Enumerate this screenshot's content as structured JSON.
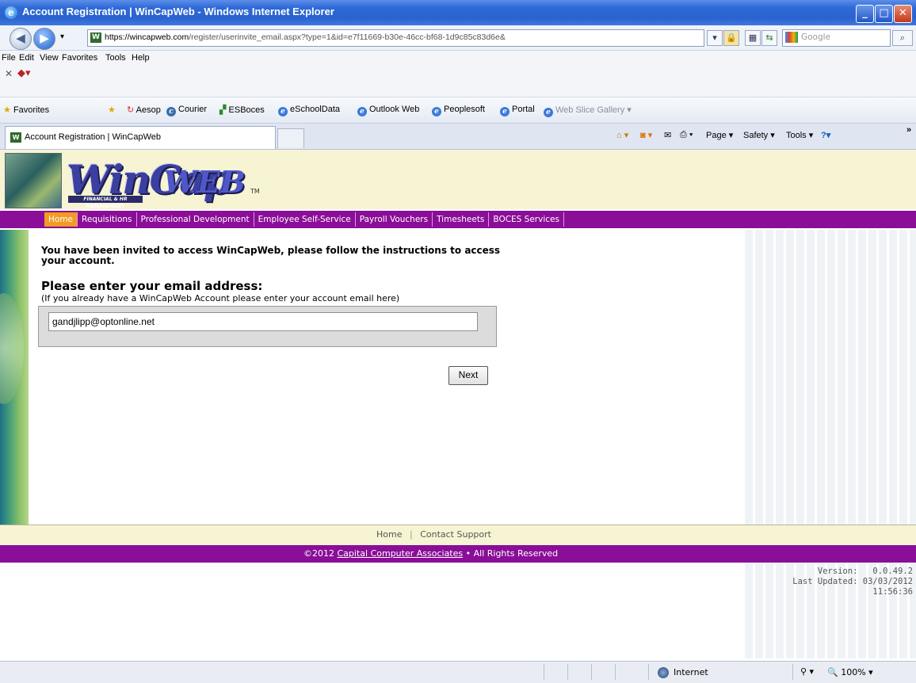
{
  "window": {
    "title": "Account Registration | WinCapWeb - Windows Internet Explorer",
    "minimize_icon": "minimize-icon",
    "maximize_icon": "maximize-icon",
    "close_icon": "close-icon"
  },
  "address": {
    "url_host": "https://wincapweb.com",
    "url_path": "/register/userinvite_email.aspx?type=1&id=e7f11669-b30e-46cc-bf68-1d9c85c83d6e&",
    "search_placeholder": "Google"
  },
  "menu": [
    "File",
    "Edit",
    "View",
    "Favorites",
    "Tools",
    "Help"
  ],
  "favorites_bar": {
    "favorites_label": "Favorites",
    "items": [
      "Aesop",
      "Courier",
      "ESBoces",
      "eSchoolData",
      "Outlook Web",
      "Peoplesoft",
      "Portal",
      "Web Slice Gallery"
    ]
  },
  "tab": {
    "label": "Account Registration | WinCapWeb"
  },
  "commands": {
    "page": "Page",
    "safety": "Safety",
    "tools": "Tools"
  },
  "logo": {
    "word": "WinCap",
    "web": "WEB",
    "sub": "FINANCIAL & HR MANAGEMENT",
    "tm": "TM"
  },
  "nav": [
    "Home",
    "Requisitions",
    "Professional Development",
    "Employee Self-Service",
    "Payroll Vouchers",
    "Timesheets",
    "BOCES Services"
  ],
  "main": {
    "invite_message": "You have been invited to access WinCapWeb, please follow the instructions to access your account.",
    "heading": "Please enter your email address:",
    "hint": "(If you already have a WinCapWeb Account please enter your account email here)",
    "email_value": "gandjlipp@optonline.net",
    "next_label": "Next"
  },
  "footer": {
    "home": "Home",
    "contact": "Contact Support",
    "copyright": "©2012",
    "company": "Capital Computer Associates",
    "rights": "• All Rights Reserved",
    "version_label": "Version:",
    "version_value": "0.0.49.2",
    "last_updated": "Last Updated: 03/03/2012",
    "time": "11:56:36"
  },
  "status": {
    "zone": "Internet",
    "zoom": "100%"
  }
}
